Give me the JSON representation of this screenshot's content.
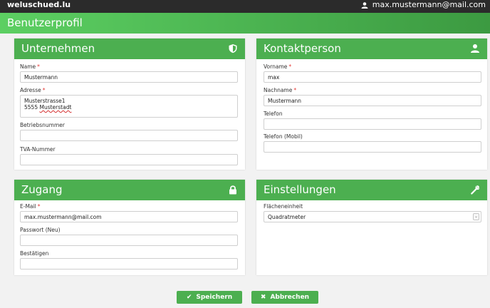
{
  "topbar": {
    "brand": "weluschued.lu",
    "user_email": "max.mustermann@mail.com"
  },
  "page": {
    "title": "Benutzerprofil"
  },
  "unternehmen": {
    "title": "Unternehmen",
    "icon": "shield-icon",
    "name_label": "Name",
    "name_value": "Mustermann",
    "adresse_label": "Adresse",
    "adresse_line1": "Musterstrasse1",
    "adresse_line2_num": "5555",
    "adresse_line2_city": "Musterstadt",
    "betriebsnummer_label": "Betriebsnummer",
    "betriebsnummer_value": "",
    "tva_label": "TVA-Nummer",
    "tva_value": ""
  },
  "kontaktperson": {
    "title": "Kontaktperson",
    "icon": "user-icon",
    "vorname_label": "Vorname",
    "vorname_value": "max",
    "nachname_label": "Nachname",
    "nachname_value": "Mustermann",
    "telefon_label": "Telefon",
    "telefon_value": "",
    "telefon_mobil_label": "Telefon (Mobil)",
    "telefon_mobil_value": ""
  },
  "zugang": {
    "title": "Zugang",
    "icon": "lock-icon",
    "email_label": "E-Mail",
    "email_value": "max.mustermann@mail.com",
    "passwort_label": "Passwort (Neu)",
    "passwort_value": "",
    "bestaetigen_label": "Bestätigen",
    "bestaetigen_value": ""
  },
  "einstellungen": {
    "title": "Einstellungen",
    "icon": "wrench-icon",
    "flaecheneinheit_label": "Flächeneinheit",
    "flaecheneinheit_value": "Quadratmeter"
  },
  "required_marker": "*",
  "buttons": {
    "save_label": "Speichern",
    "cancel_label": "Abbrechen"
  },
  "colors": {
    "accent": "#4caf50",
    "required": "#e53935",
    "topbar": "#2b2b2b"
  }
}
